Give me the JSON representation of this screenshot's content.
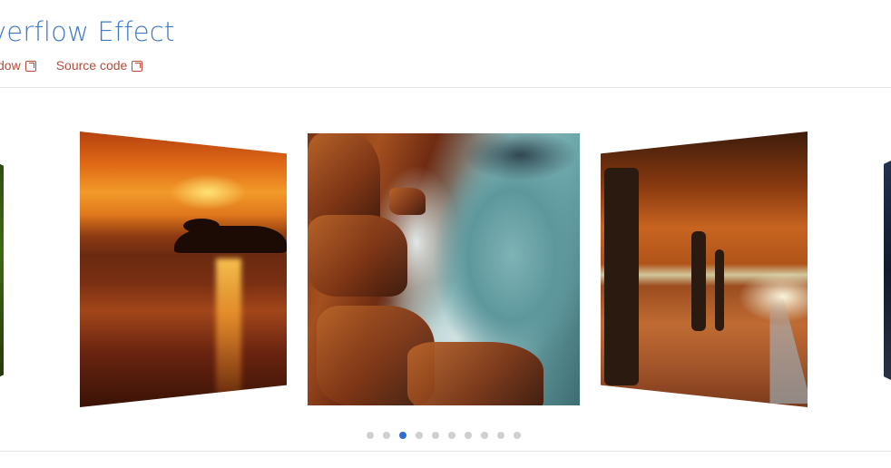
{
  "header": {
    "title": "overflow Effect",
    "links": [
      {
        "label": "w window"
      },
      {
        "label": "Source code"
      }
    ]
  },
  "carousel": {
    "dots_count": 10,
    "active_index": 2
  },
  "colors": {
    "title": "#3f79c9",
    "link": "#b84a3a",
    "dot": "#cfcfcf",
    "dot_active": "#2d6fd6"
  },
  "icons": {
    "external_link": "external-link-icon"
  }
}
